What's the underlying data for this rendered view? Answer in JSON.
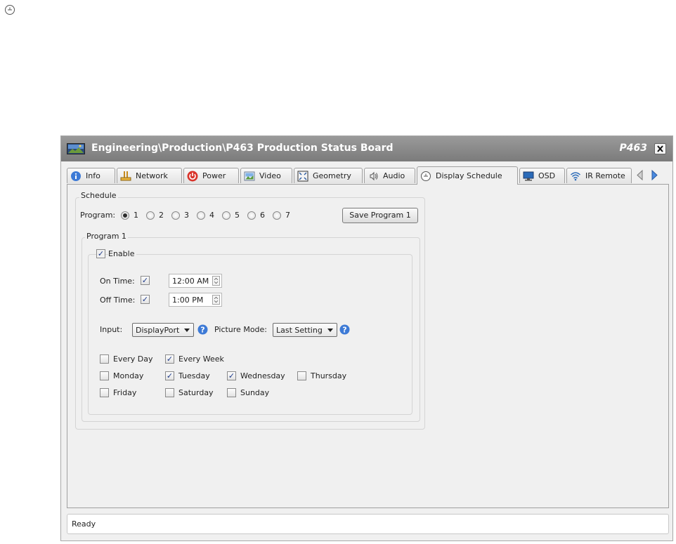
{
  "window": {
    "title": "Engineering\\Production\\P463 Production Status Board",
    "model": "P463"
  },
  "tabs": [
    {
      "label": "Info",
      "icon": "info-icon"
    },
    {
      "label": "Network",
      "icon": "network-icon"
    },
    {
      "label": "Power",
      "icon": "power-icon"
    },
    {
      "label": "Video",
      "icon": "video-icon"
    },
    {
      "label": "Geometry",
      "icon": "geometry-icon"
    },
    {
      "label": "Audio",
      "icon": "audio-icon"
    },
    {
      "label": "Display Schedule",
      "icon": "clock-icon",
      "active": true
    },
    {
      "label": "OSD",
      "icon": "monitor-icon"
    },
    {
      "label": "IR Remote",
      "icon": "wireless-icon"
    }
  ],
  "schedule": {
    "group_title": "Schedule",
    "program_label": "Program:",
    "programs": [
      "1",
      "2",
      "3",
      "4",
      "5",
      "6",
      "7"
    ],
    "selected_program": "1",
    "save_button": "Save Program 1"
  },
  "program": {
    "group_title": "Program 1",
    "enable_label": "Enable",
    "enabled": true,
    "on_time_label": "On Time:",
    "on_time_checked": true,
    "on_time_value": "12:00 AM",
    "off_time_label": "Off Time:",
    "off_time_checked": true,
    "off_time_value": "1:00 PM",
    "input_label": "Input:",
    "input_value": "DisplayPort",
    "picture_mode_label": "Picture Mode:",
    "picture_mode_value": "Last Setting"
  },
  "days": {
    "every_day": {
      "label": "Every Day",
      "checked": false
    },
    "every_week": {
      "label": "Every Week",
      "checked": true
    },
    "monday": {
      "label": "Monday",
      "checked": false
    },
    "tuesday": {
      "label": "Tuesday",
      "checked": true
    },
    "wednesday": {
      "label": "Wednesday",
      "checked": true
    },
    "thursday": {
      "label": "Thursday",
      "checked": false
    },
    "friday": {
      "label": "Friday",
      "checked": false
    },
    "saturday": {
      "label": "Saturday",
      "checked": false
    },
    "sunday": {
      "label": "Sunday",
      "checked": false
    }
  },
  "status": {
    "text": "Ready"
  },
  "colors": {
    "titlebar": "#7b7b7b",
    "help_icon": "#3d7ad6",
    "power_icon": "#d9342b",
    "check": "#1d3a8a"
  }
}
